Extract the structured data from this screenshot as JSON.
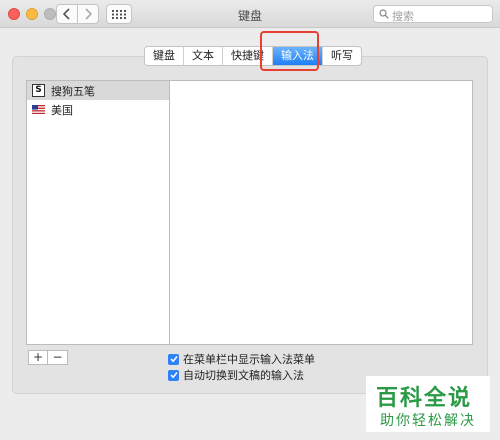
{
  "window": {
    "title": "键盘",
    "search_placeholder": "搜索"
  },
  "tabs": [
    {
      "label": "键盘",
      "active": false
    },
    {
      "label": "文本",
      "active": false
    },
    {
      "label": "快捷键",
      "active": false
    },
    {
      "label": "输入法",
      "active": true
    },
    {
      "label": "听写",
      "active": false
    }
  ],
  "input_sources": [
    {
      "label": "搜狗五笔",
      "icon": "sogou-icon",
      "selected": true
    },
    {
      "label": "美国",
      "icon": "us-flag-icon",
      "selected": false
    }
  ],
  "list_controls": {
    "add_label": "+",
    "remove_label": "−"
  },
  "options": {
    "show_menu_label": "在菜单栏中显示输入法菜单",
    "show_menu_checked": true,
    "auto_switch_label": "自动切换到文稿的输入法",
    "auto_switch_checked": true
  },
  "watermark": {
    "title": "百科全说",
    "subtitle": "助你轻松解决"
  },
  "colors": {
    "accent": "#1f7ff5",
    "highlight_box": "#e83f33",
    "watermark_green": "#2a9a45"
  }
}
